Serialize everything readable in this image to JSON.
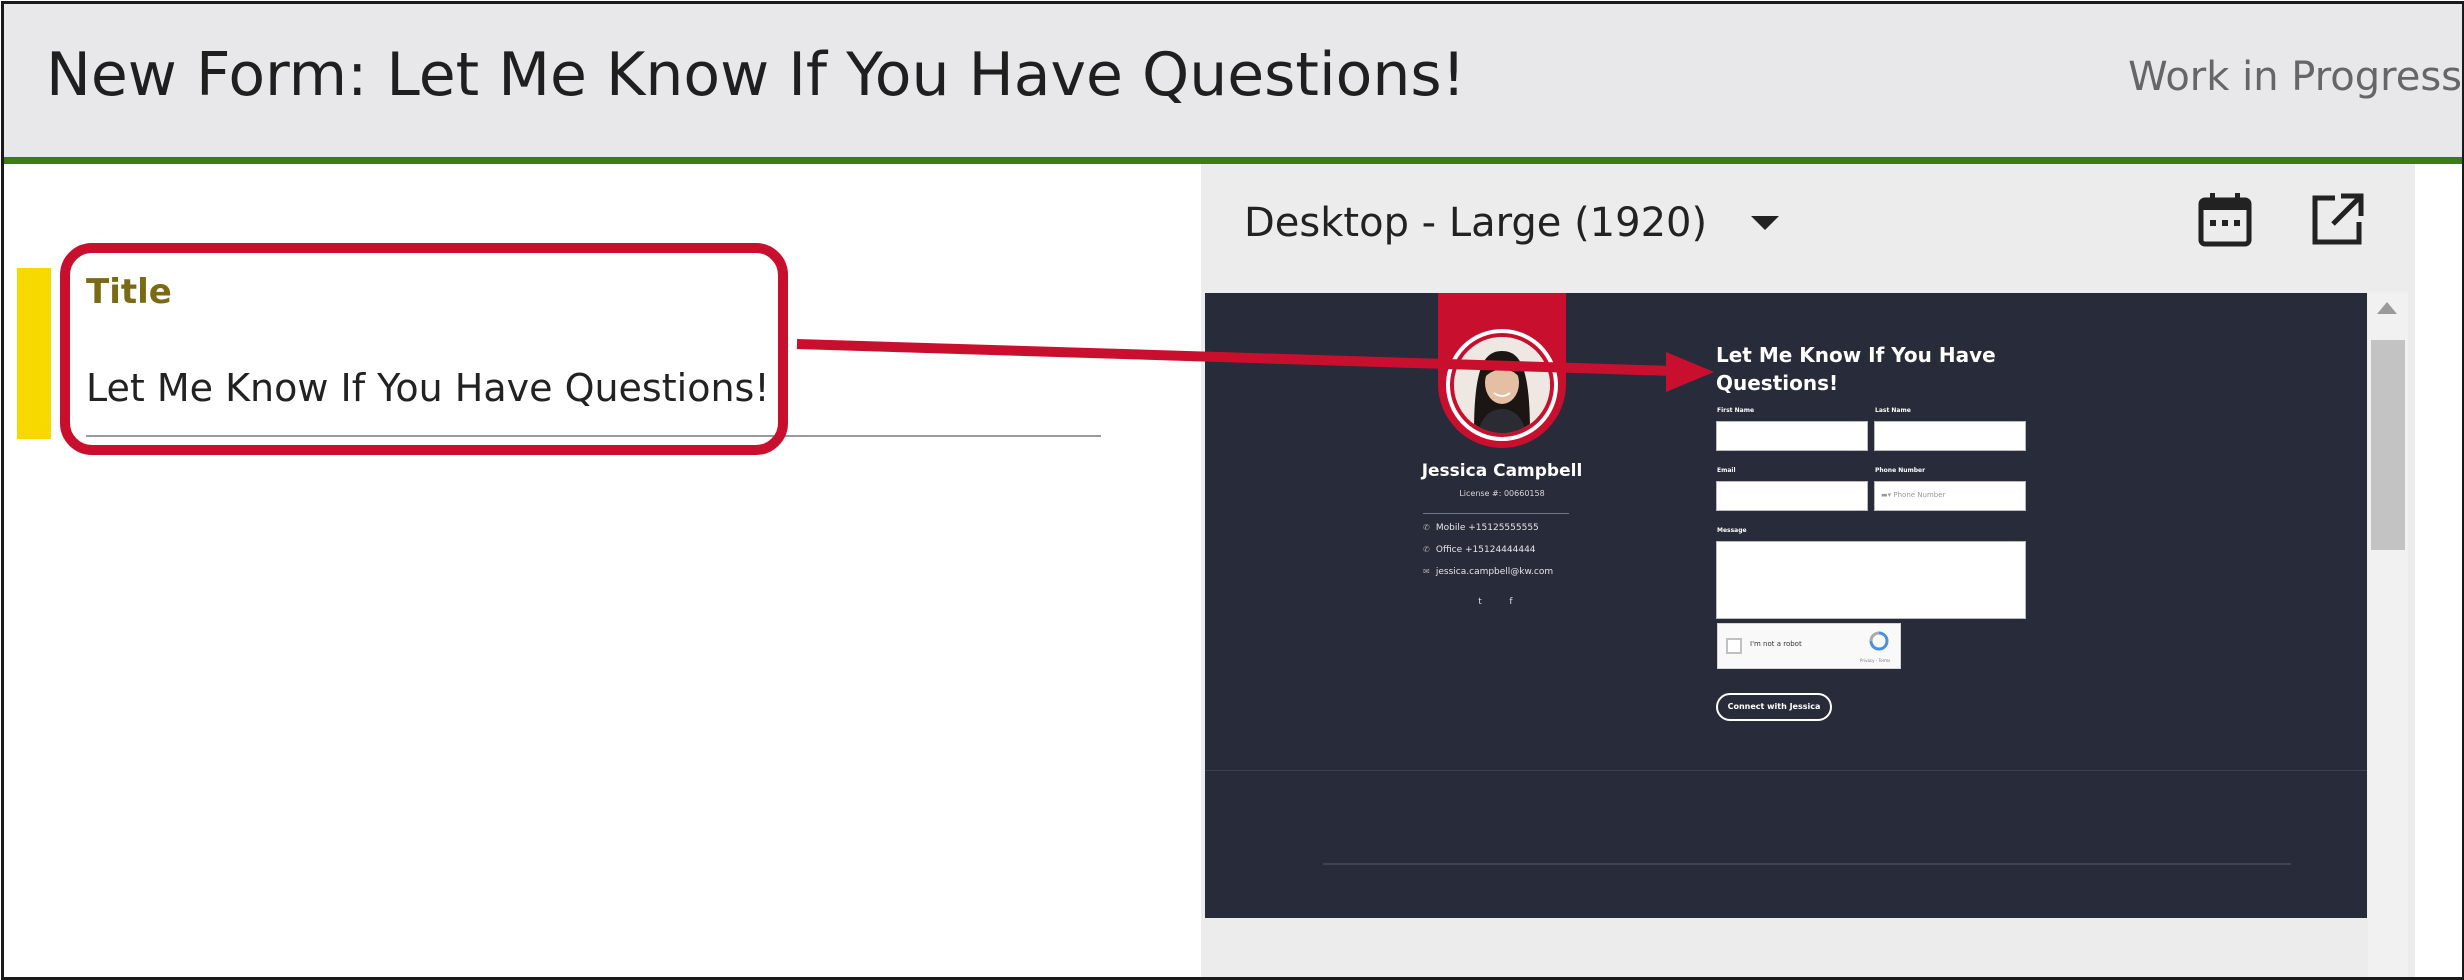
{
  "header": {
    "title": "New Form: Let Me Know If You Have Questions!",
    "status": "Work in Progress"
  },
  "field": {
    "label": "Title",
    "value": "Let Me Know If You Have Questions!"
  },
  "toolbar": {
    "device_label": "Desktop - Large (1920)",
    "icons": [
      "calendar-icon",
      "open-external-icon"
    ]
  },
  "preview": {
    "agent": {
      "name": "Jessica Campbell",
      "license": "License #: 00660158",
      "mobile": "Mobile +15125555555",
      "office": "Office +15124444444",
      "email": "jessica.campbell@kw.com",
      "social_icons": [
        "twitter-icon",
        "facebook-icon"
      ]
    },
    "form": {
      "title": "Let Me Know If You Have Questions!",
      "first_name_label": "First Name",
      "last_name_label": "Last Name",
      "email_label": "Email",
      "phone_label": "Phone Number",
      "phone_placeholder": "Phone Number",
      "message_label": "Message",
      "recaptcha_text": "I'm not a robot",
      "recaptcha_small": "Privacy - Terms",
      "submit_label": "Connect with Jessica"
    }
  },
  "colors": {
    "header_bg": "#e8e8ea",
    "header_border": "#3f7a12",
    "accent_yellow": "#f7d900",
    "annotation_red": "#c8102e",
    "preview_bg": "#282b3a"
  }
}
